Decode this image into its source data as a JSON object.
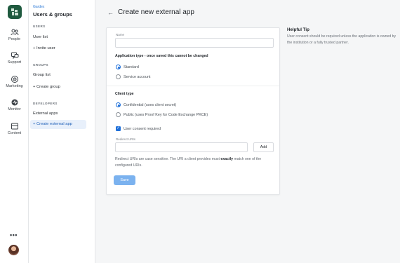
{
  "rail": {
    "items": [
      {
        "label": "People",
        "icon": "people-icon"
      },
      {
        "label": "Support",
        "icon": "support-icon"
      },
      {
        "label": "Marketing",
        "icon": "marketing-icon"
      },
      {
        "label": "Monitor",
        "icon": "monitor-icon"
      },
      {
        "label": "Content",
        "icon": "content-icon"
      }
    ],
    "more": "•••"
  },
  "subnav": {
    "org": "Gardex",
    "title": "Users & groups",
    "sections": [
      {
        "heading": "USERS",
        "items": [
          "User list",
          "+ Invite user"
        ]
      },
      {
        "heading": "GROUPS",
        "items": [
          "Group list",
          "+ Create group"
        ]
      },
      {
        "heading": "DEVELOPERS",
        "items": [
          "External apps",
          "+ Create external app"
        ]
      }
    ]
  },
  "page": {
    "back_icon": "←",
    "title": "Create new external app"
  },
  "form": {
    "name_label": "Name",
    "name_value": "",
    "app_type_title": "Application type - once saved this cannot be changed",
    "app_type_options": [
      "Standard",
      "Service account"
    ],
    "app_type_selected": "Standard",
    "client_type_title": "Client type",
    "client_type_options": [
      "Confidential (uses client secret)",
      "Public (uses Proof Key for Code Exchange PKCE)"
    ],
    "client_type_selected": "Confidential (uses client secret)",
    "consent_label": "User consent required",
    "consent_checked": true,
    "redirect_label": "Redirect URIs",
    "redirect_value": "",
    "add_label": "Add",
    "help_pre": "Redirect URIs are case sensitive. The URI a client provides must ",
    "help_bold": "exactly",
    "help_post": " match one of the configured URIs.",
    "save_label": "Save"
  },
  "tip": {
    "title": "Helpful Tip",
    "text": "User consent should be required unless the application is owned by the institution or a fully trusted partner."
  },
  "colors": {
    "accent": "#1e6fd9",
    "brand": "#1f5a3f",
    "save_disabled": "#7bb2ef",
    "active_bg": "#e8f0fb"
  }
}
